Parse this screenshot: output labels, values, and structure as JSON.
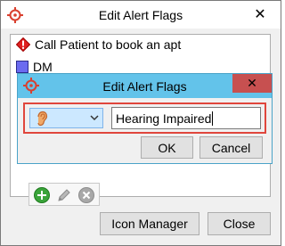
{
  "outer_window": {
    "title": "Edit Alert Flags",
    "close_glyph": "✕"
  },
  "flags": [
    {
      "icon": "alert-diamond-icon",
      "color": "#e02020",
      "label": "Call Patient to book an apt"
    },
    {
      "icon": "blue-square-icon",
      "color": "#6b6bf0",
      "label": "DM"
    }
  ],
  "buttons": {
    "icon_manager": "Icon Manager",
    "close": "Close"
  },
  "toolbar": {
    "add_icon": "add-icon",
    "edit_icon": "edit-icon",
    "delete_icon": "delete-icon"
  },
  "inner_dialog": {
    "title": "Edit Alert Flags",
    "close_glyph": "✕",
    "selected_icon": "ear-icon",
    "text_value": "Hearing Impaired",
    "ok_label": "OK",
    "cancel_label": "Cancel",
    "highlight_color": "#e0463c",
    "titlebar_color": "#63c3ea"
  }
}
